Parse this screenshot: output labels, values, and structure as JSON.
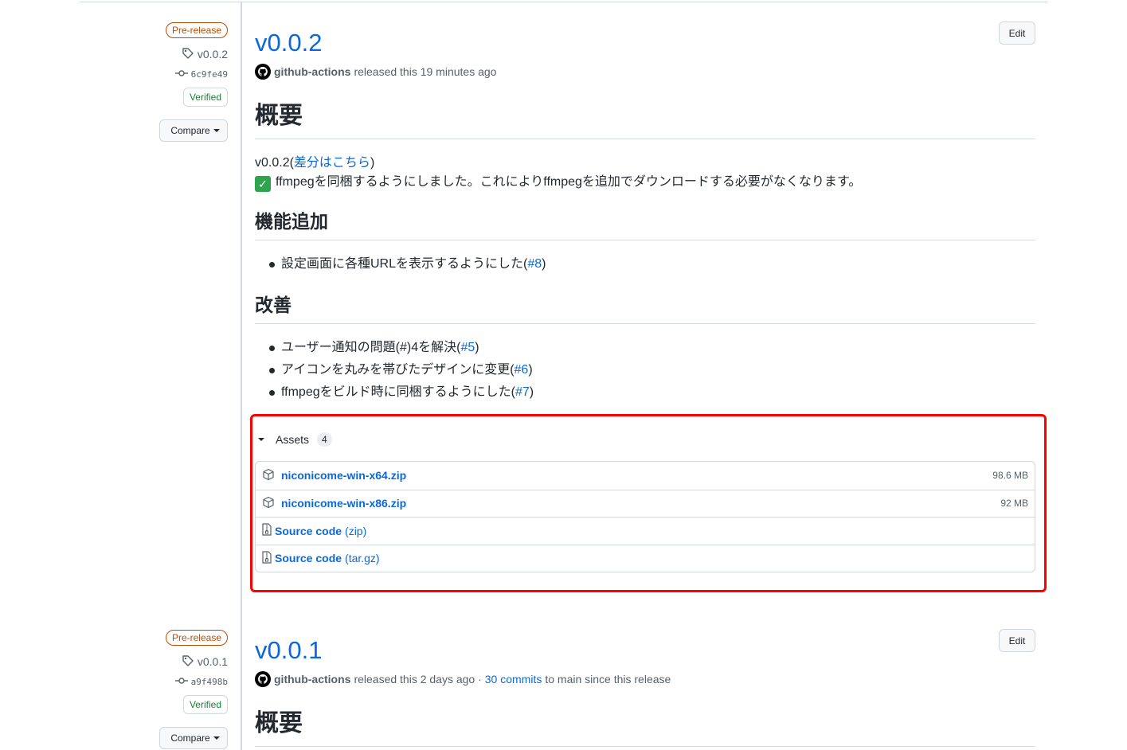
{
  "colors": {
    "link": "#0969da",
    "prerelease": "#bc4c00",
    "verified": "#1a7f37",
    "highlight": "#ff0000"
  },
  "releases": [
    {
      "badge": "Pre-release",
      "tag": "v0.0.2",
      "commit": "6c9fe49",
      "verified": "Verified",
      "compare": "Compare",
      "title": "v0.0.2",
      "edit": "Edit",
      "author": "github-actions",
      "released_text": "released this 19 minutes ago",
      "h_overview": "概要",
      "version_line": "v0.0.2(",
      "diff_link": "差分はこちら",
      "version_close": ")",
      "note": "ffmpegを同梱するようにしました。これによりffmpegを追加でダウンロードする必要がなくなります。",
      "h_features": "機能追加",
      "features": [
        {
          "text": "設定画面に各種URLを表示するようにした(",
          "link": "#8",
          "close": " )"
        }
      ],
      "h_improve": "改善",
      "improvements": [
        {
          "text": "ユーザー通知の問題(#)4を解決(",
          "link": "#5",
          "close": ")"
        },
        {
          "text": "アイコンを丸みを帯びたデザインに変更(",
          "link": "#6",
          "close": " )"
        },
        {
          "text": "ffmpegをビルド時に同梱するようにした(",
          "link": "#7",
          "close": " )"
        }
      ],
      "assets": {
        "label": "Assets",
        "count": "4",
        "files": [
          {
            "name": "niconicome-win-x64.zip",
            "size": "98.6 MB"
          },
          {
            "name": "niconicome-win-x86.zip",
            "size": "92 MB"
          }
        ],
        "sources": [
          {
            "name": "Source code",
            "fmt": "(zip)"
          },
          {
            "name": "Source code",
            "fmt": "(tar.gz)"
          }
        ]
      }
    },
    {
      "badge": "Pre-release",
      "tag": "v0.0.1",
      "commit": "a9f498b",
      "verified": "Verified",
      "compare": "Compare",
      "title": "v0.0.1",
      "edit": "Edit",
      "author": "github-actions",
      "released_text": "released this 2 days ago ·",
      "commits_link": "30 commits",
      "commits_suffix": "to main since this release",
      "h_overview": "概要"
    }
  ]
}
